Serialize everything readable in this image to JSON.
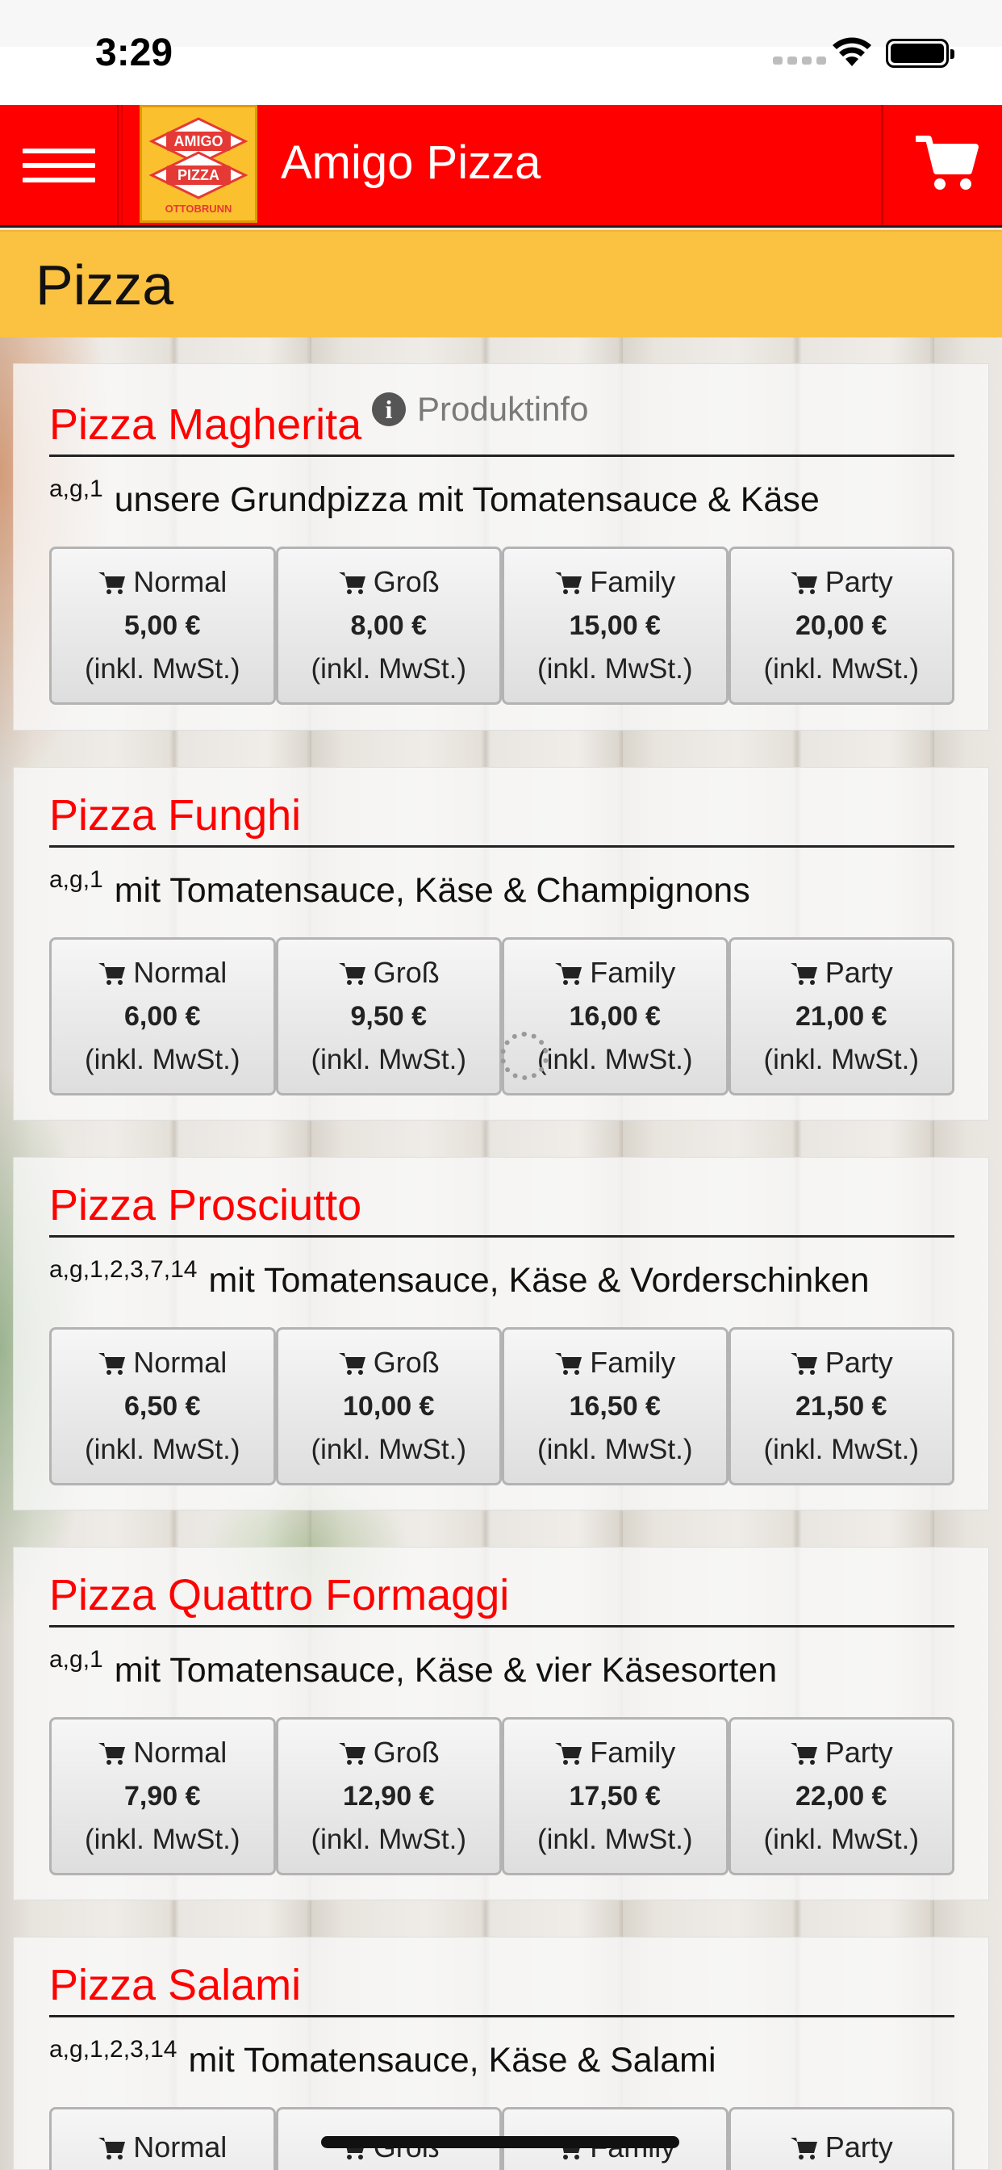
{
  "status": {
    "time": "3:29"
  },
  "header": {
    "title": "Amigo Pizza",
    "logo_top": "AMIGO",
    "logo_mid": "PIZZA",
    "logo_bottom": "OTTOBRUNN"
  },
  "category": {
    "title": "Pizza"
  },
  "product_info_label": "Produktinfo",
  "tax_label": "(inkl. MwSt.)",
  "sizes": [
    "Normal",
    "Groß",
    "Family",
    "Party"
  ],
  "products": [
    {
      "name": "Pizza Magherita",
      "allergens": "a,g,1",
      "description": "unsere Grundpizza mit Tomatensauce & Käse",
      "prices": [
        "5,00 €",
        "8,00 €",
        "15,00 €",
        "20,00 €"
      ]
    },
    {
      "name": "Pizza Funghi",
      "allergens": "a,g,1",
      "description": "mit Tomatensauce, Käse & Champignons",
      "prices": [
        "6,00 €",
        "9,50 €",
        "16,00 €",
        "21,00 €"
      ]
    },
    {
      "name": "Pizza Prosciutto",
      "allergens": "a,g,1,2,3,7,14",
      "description": "mit Tomatensauce, Käse & Vorderschinken",
      "prices": [
        "6,50 €",
        "10,00 €",
        "16,50 €",
        "21,50 €"
      ]
    },
    {
      "name": "Pizza Quattro Formaggi",
      "allergens": "a,g,1",
      "description": "mit Tomatensauce, Käse & vier Käsesorten",
      "prices": [
        "7,90 €",
        "12,90 €",
        "17,50 €",
        "22,00 €"
      ]
    },
    {
      "name": "Pizza Salami",
      "allergens": "a,g,1,2,3,14",
      "description": "mit Tomatensauce, Käse & Salami",
      "prices": [
        "",
        "",
        "",
        ""
      ]
    }
  ],
  "colors": {
    "header": "#ff0000",
    "category_bar": "#fbc141",
    "product_name": "#ff0000"
  }
}
